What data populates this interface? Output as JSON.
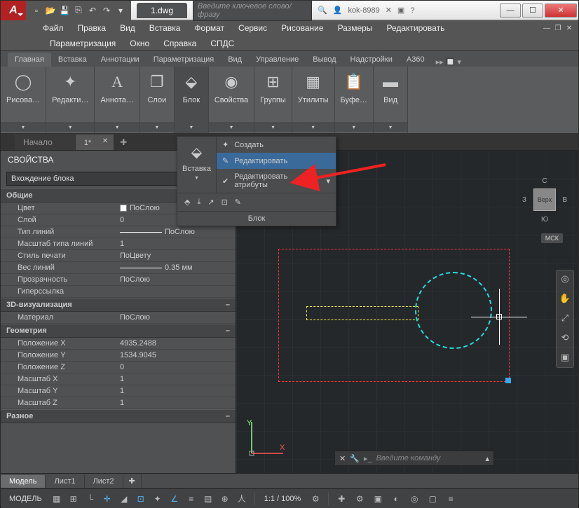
{
  "title": "1.dwg",
  "search_placeholder": "Введите ключевое слово/фразу",
  "user": "kok-8989",
  "menu1": [
    "Файл",
    "Правка",
    "Вид",
    "Вставка",
    "Формат",
    "Сервис",
    "Рисование",
    "Размеры",
    "Редактировать"
  ],
  "menu2": [
    "Параметризация",
    "Окно",
    "Справка",
    "СПДС"
  ],
  "ribbon_tabs": [
    "Главная",
    "Вставка",
    "Аннотации",
    "Параметризация",
    "Вид",
    "Управление",
    "Вывод",
    "Надстройки",
    "A360"
  ],
  "panels": [
    "Рисова…",
    "Редакти…",
    "Аннота…",
    "Слои",
    "Блок",
    "Свойства",
    "Группы",
    "Утилиты",
    "Буфе…",
    "Вид"
  ],
  "file_tabs": {
    "start": "Начало",
    "current": "1*"
  },
  "properties": {
    "title": "СВОЙСТВА",
    "selection": "Вхождение блока",
    "groups": {
      "general": {
        "label": "Общие",
        "rows": [
          {
            "k": "Цвет",
            "v": "ПоСлою",
            "sw": true
          },
          {
            "k": "Слой",
            "v": "0"
          },
          {
            "k": "Тип линий",
            "v": "ПоСлою",
            "line": true
          },
          {
            "k": "Масштаб типа линий",
            "v": "1"
          },
          {
            "k": "Стиль печати",
            "v": "ПоЦвету"
          },
          {
            "k": "Вес линий",
            "v": "0.35 мм",
            "line": true
          },
          {
            "k": "Прозрачность",
            "v": "ПоСлою"
          },
          {
            "k": "Гиперссылка",
            "v": ""
          }
        ]
      },
      "viz": {
        "label": "3D-визуализация",
        "rows": [
          {
            "k": "Материал",
            "v": "ПоСлою"
          }
        ]
      },
      "geom": {
        "label": "Геометрия",
        "rows": [
          {
            "k": "Положение X",
            "v": "4935.2488"
          },
          {
            "k": "Положение Y",
            "v": "1534.9045"
          },
          {
            "k": "Положение Z",
            "v": "0"
          },
          {
            "k": "Масштаб X",
            "v": "1"
          },
          {
            "k": "Масштаб Y",
            "v": "1"
          },
          {
            "k": "Масштаб Z",
            "v": "1"
          }
        ]
      },
      "misc": {
        "label": "Разное"
      }
    }
  },
  "dropdown": {
    "left_label": "Вставка",
    "items": [
      "Создать",
      "Редактировать",
      "Редактировать атрибуты"
    ],
    "footer": "Блок"
  },
  "viewcube": {
    "face": "Верх",
    "n": "С",
    "s": "Ю",
    "e": "В",
    "w": "З",
    "wcs": "МСК"
  },
  "cmd_placeholder": "Введите команду",
  "model_tabs": [
    "Модель",
    "Лист1",
    "Лист2"
  ],
  "status_text": "МОДЕЛЬ",
  "zoom": "1:1 / 100%",
  "chart_data": {
    "type": "diagram",
    "note": "CAD canvas selection: red dashed bounding rectangle, yellow dashed rectangle, cyan dashed circle, blue grip at lower-right",
    "objects": [
      {
        "shape": "rect",
        "color": "#f33",
        "style": "dashed",
        "role": "selection-bbox"
      },
      {
        "shape": "rect",
        "color": "#ee3",
        "style": "dashed",
        "role": "block-entity"
      },
      {
        "shape": "circle",
        "color": "#2dd",
        "style": "dashed",
        "role": "block-entity"
      }
    ]
  }
}
